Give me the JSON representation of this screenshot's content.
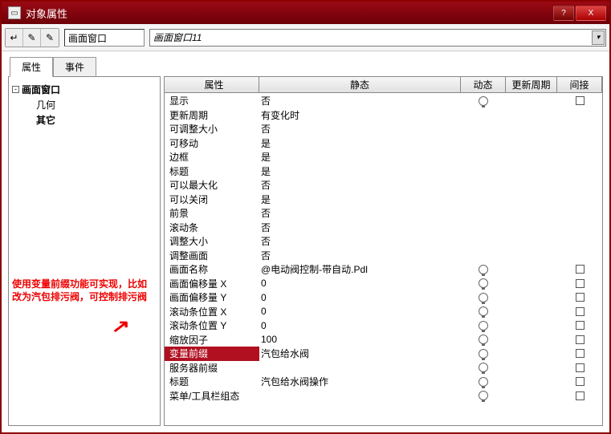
{
  "window": {
    "title": "对象属性",
    "help_symbol": "?",
    "close_symbol": "X"
  },
  "toolbar": {
    "btn1_glyph": "↵",
    "btn2_glyph": "✎",
    "btn3_glyph": "✎",
    "object_name": "画面窗口",
    "combo_value": "画面窗口11",
    "combo_glyph": "▾"
  },
  "tabs": {
    "tab1": "属性",
    "tab2": "事件"
  },
  "tree": {
    "minus_glyph": "-",
    "root": "画面窗口",
    "child1": "几何",
    "child2": "其它",
    "note_text": "使用变量前缀功能可实现，比如改为汽包排污阀，可控制排污阀",
    "arrow_glyph": "↗"
  },
  "grid": {
    "headers": {
      "attr": "属性",
      "static": "静态",
      "dynamic": "动态",
      "update": "更新周期",
      "indirect": "间接"
    },
    "rows": [
      {
        "attr": "显示",
        "static": "否",
        "bulb": true,
        "chk": true
      },
      {
        "attr": "更新周期",
        "static": "有变化时"
      },
      {
        "attr": "可调整大小",
        "static": "否"
      },
      {
        "attr": "可移动",
        "static": "是"
      },
      {
        "attr": "边框",
        "static": "是"
      },
      {
        "attr": "标题",
        "static": "是"
      },
      {
        "attr": "可以最大化",
        "static": "否"
      },
      {
        "attr": "可以关闭",
        "static": "是"
      },
      {
        "attr": "前景",
        "static": "否"
      },
      {
        "attr": "滚动条",
        "static": "否"
      },
      {
        "attr": "调整大小",
        "static": "否"
      },
      {
        "attr": "调整画面",
        "static": "否"
      },
      {
        "attr": "画面名称",
        "static": "@电动阀控制-带自动.Pdl",
        "bulb": true,
        "chk": true
      },
      {
        "attr": "画面偏移量 X",
        "static": "0",
        "bulb": true,
        "chk": true
      },
      {
        "attr": "画面偏移量 Y",
        "static": "0",
        "bulb": true,
        "chk": true
      },
      {
        "attr": "滚动条位置 X",
        "static": "0",
        "bulb": true,
        "chk": true
      },
      {
        "attr": "滚动条位置 Y",
        "static": "0",
        "bulb": true,
        "chk": true
      },
      {
        "attr": "缩放因子",
        "static": "100",
        "bulb": true,
        "chk": true
      },
      {
        "attr": "变量前缀",
        "static": "汽包给水阀",
        "bulb": true,
        "chk": true,
        "sel": true
      },
      {
        "attr": "服务器前缀",
        "static": "",
        "bulb": true,
        "chk": true
      },
      {
        "attr": "标题",
        "static": "汽包给水阀操作",
        "bulb": true,
        "chk": true
      },
      {
        "attr": "菜单/工具栏组态",
        "static": "",
        "bulb": true,
        "chk": true
      }
    ]
  }
}
